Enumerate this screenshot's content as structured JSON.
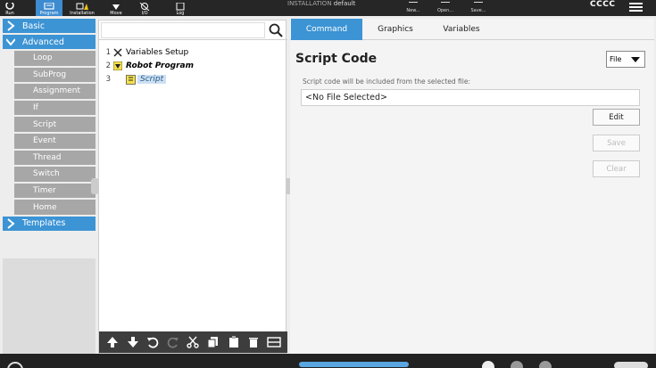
{
  "topbar": {
    "tabs": [
      {
        "label": "Run",
        "icon": "run-icon"
      },
      {
        "label": "Program",
        "icon": "program-icon"
      },
      {
        "label": "Installation",
        "icon": "installation-icon"
      },
      {
        "label": "Move",
        "icon": "move-icon"
      },
      {
        "label": "I/O",
        "icon": "io-icon"
      },
      {
        "label": "Log",
        "icon": "log-icon"
      }
    ],
    "installation_label": "INSTALLATION",
    "installation_name": "default",
    "file_buttons": [
      "New...",
      "Open...",
      "Save..."
    ],
    "user": "CCCC"
  },
  "nav": {
    "basic": "Basic",
    "advanced": "Advanced",
    "items": [
      "Loop",
      "SubProg",
      "Assignment",
      "If",
      "Script",
      "Event",
      "Thread",
      "Switch",
      "Timer",
      "Home"
    ],
    "templates": "Templates"
  },
  "tree": {
    "rows": [
      {
        "num": "1",
        "label": "Variables Setup"
      },
      {
        "num": "2",
        "label": "Robot Program"
      },
      {
        "num": "3",
        "label": "Script"
      }
    ]
  },
  "right": {
    "tabs": [
      "Command",
      "Graphics",
      "Variables"
    ],
    "title": "Script Code",
    "select_value": "File",
    "hint": "Script code will be included from the selected file:",
    "file_value": "<No File Selected>",
    "buttons": {
      "edit": "Edit",
      "save": "Save",
      "clear": "Clear"
    }
  },
  "colors": {
    "accent": "#3c94d4",
    "nav_item": "#a7a7a7",
    "topbar": "#262626"
  }
}
